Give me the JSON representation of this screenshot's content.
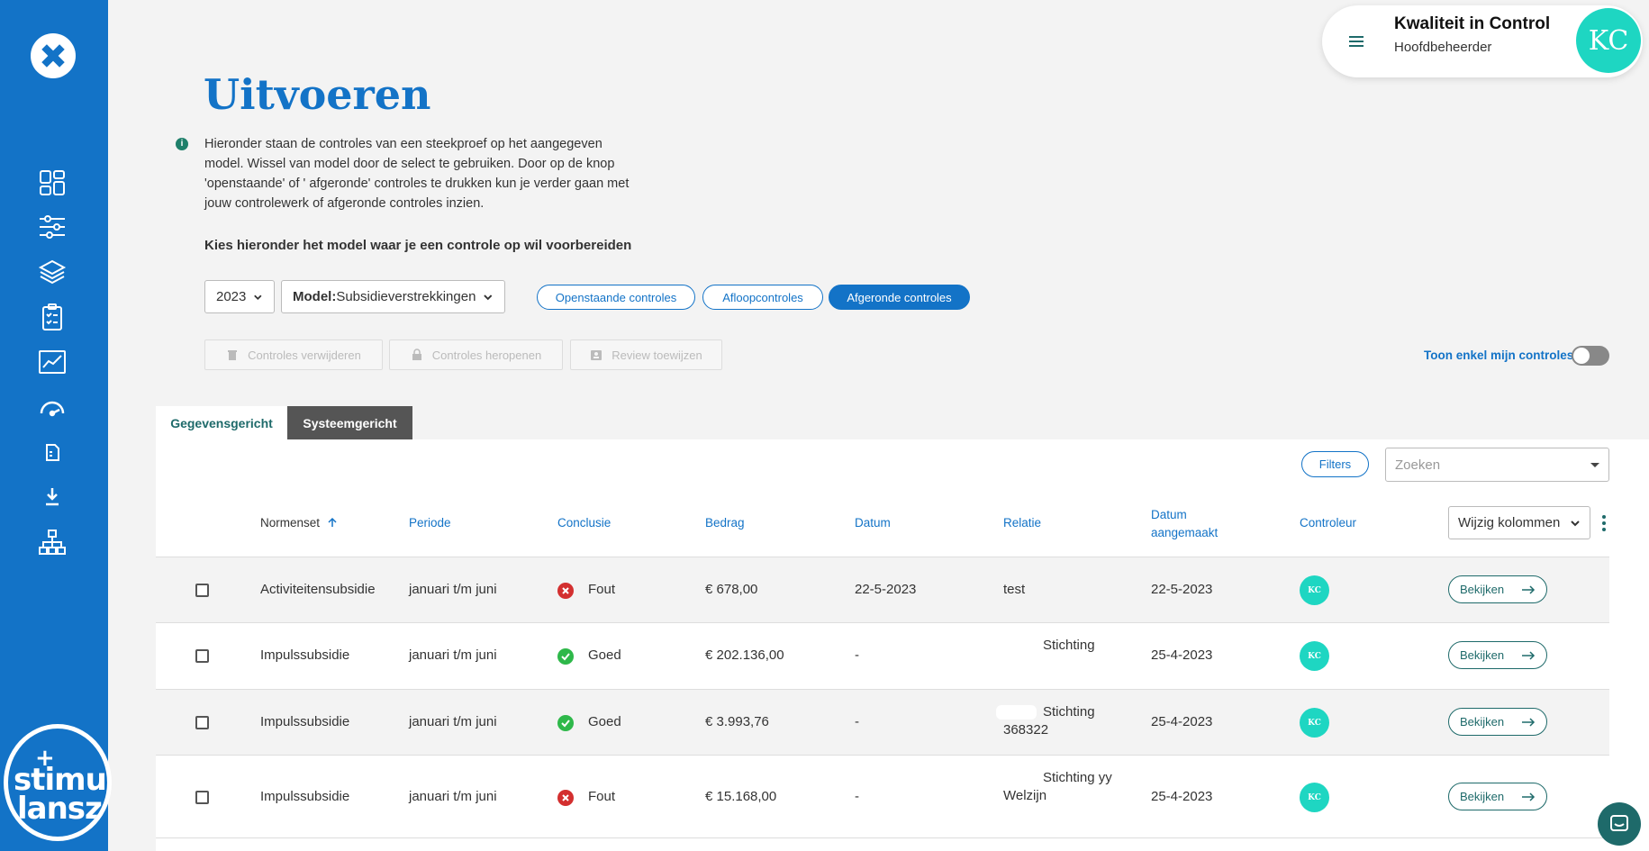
{
  "user": {
    "name": "Kwaliteit in Control",
    "role": "Hoofdbeheerder",
    "initials": "KC"
  },
  "brand": {
    "line1": "stimu",
    "line2": "lansz",
    "plus": "+"
  },
  "page": {
    "title": "Uitvoeren",
    "info_icon": "i",
    "intro": "Hieronder staan de controles van een steekproef op het aangegeven model. Wissel van model door de select te gebruiken. Door op de knop 'openstaande' of ' afgeronde' controles te drukken kun je verder gaan met jouw controlewerk of afgeronde controles inzien.",
    "choose_label": "Kies hieronder het model waar je een controle op wil voorbereiden"
  },
  "filters": {
    "year": "2023",
    "model_prefix": "Model:",
    "model_value": "Subsidieverstrekkingen",
    "pills": [
      "Openstaande controles",
      "Afloopcontroles",
      "Afgeronde controles"
    ],
    "active_pill": "Afgeronde controles"
  },
  "actions": {
    "delete": "Controles verwijderen",
    "reopen": "Controles heropenen",
    "review": "Review toewijzen"
  },
  "toggle": {
    "label": "Toon enkel mijn controles",
    "on": false
  },
  "tabs": [
    "Gegevensgericht",
    "Systeemgericht"
  ],
  "table_tools": {
    "filters": "Filters",
    "search_placeholder": "Zoeken",
    "columns_button": "Wijzig kolommen"
  },
  "columns": {
    "normenset": "Normenset",
    "periode": "Periode",
    "conclusie": "Conclusie",
    "bedrag": "Bedrag",
    "datum": "Datum",
    "relatie": "Relatie",
    "aangemaakt_1": "Datum",
    "aangemaakt_2": "aangemaakt",
    "controleur": "Controleur"
  },
  "rows": [
    {
      "normenset": "Activiteitensubsidie",
      "periode": "januari t/m juni",
      "conclusie": "Fout",
      "status": "error",
      "bedrag": "€ 678,00",
      "datum": "22-5-2023",
      "relatie_1": "test",
      "relatie_2": "",
      "aangemaakt": "22-5-2023",
      "controleur": "KC",
      "action": "Bekijken"
    },
    {
      "normenset": "Impulssubsidie",
      "periode": "januari t/m juni",
      "conclusie": "Goed",
      "status": "ok",
      "bedrag": "€ 202.136,00",
      "datum": "-",
      "relatie_1": "Stichting",
      "relatie_2": "",
      "aangemaakt": "25-4-2023",
      "controleur": "KC",
      "action": "Bekijken"
    },
    {
      "normenset": "Impulssubsidie",
      "periode": "januari t/m juni",
      "conclusie": "Goed",
      "status": "ok",
      "bedrag": "€ 3.993,76",
      "datum": "-",
      "relatie_1": "Stichting",
      "relatie_2": "368322",
      "aangemaakt": "25-4-2023",
      "controleur": "KC",
      "action": "Bekijken"
    },
    {
      "normenset": "Impulssubsidie",
      "periode": "januari t/m juni",
      "conclusie": "Fout",
      "status": "error",
      "bedrag": "€ 15.168,00",
      "datum": "-",
      "relatie_1": "Stichting yy",
      "relatie_2": "Welzijn",
      "aangemaakt": "25-4-2023",
      "controleur": "KC",
      "action": "Bekijken"
    }
  ],
  "colors": {
    "primary": "#1373c7",
    "teal": "#1ed6c2",
    "dark_teal": "#1e6a6a",
    "error": "#d32f2f",
    "success": "#2eb84a"
  }
}
